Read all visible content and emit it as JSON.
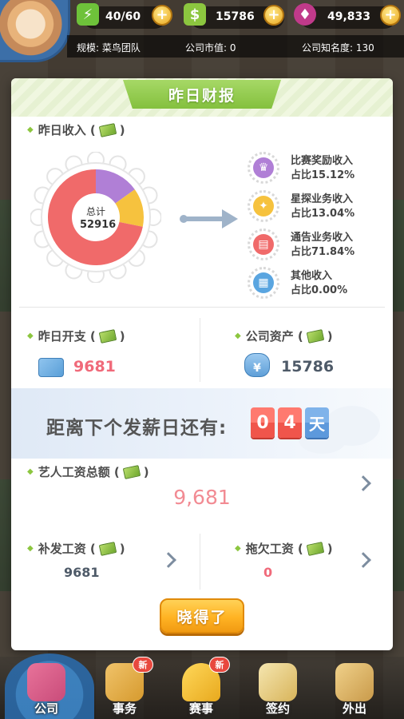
{
  "hud": {
    "energy": "40/60",
    "cash": "15786",
    "gems": "49,833",
    "plus": "+",
    "scale": "规模: 菜鸟团队",
    "market_value": "公司市值: 0",
    "fame": "公司知名度: 130"
  },
  "dialog": {
    "title": "昨日财报",
    "income_title": "昨日收入 (",
    "income_close": ")",
    "total_label": "总计",
    "total_value": "52916",
    "legend": [
      {
        "name": "比赛奖励收入",
        "pct": "占比15.12%",
        "color": "#b07fd6",
        "icon": "trophy-icon"
      },
      {
        "name": "星探业务收入",
        "pct": "占比13.04%",
        "color": "#f6c23e",
        "icon": "star-scout-icon"
      },
      {
        "name": "通告业务收入",
        "pct": "占比71.84%",
        "color": "#f06a6a",
        "icon": "clapperboard-icon"
      },
      {
        "name": "其他收入",
        "pct": "占比0.00%",
        "color": "#5aa5e0",
        "icon": "grid-icon"
      }
    ],
    "expense_title": "昨日开支 (",
    "expense_value": "9681",
    "assets_title": "公司资产 (",
    "assets_value": "15786",
    "assets_symbol": "¥",
    "countdown_text": "距离下个发薪日还有:",
    "countdown_digits": [
      "0",
      "4"
    ],
    "countdown_unit": "天",
    "wage_total_title": "艺人工资总额 (",
    "wage_total_value": "9,681",
    "backpay_title": "补发工资 (",
    "backpay_value": "9681",
    "arrears_title": "拖欠工资 (",
    "arrears_value": "0",
    "ok_button": "晓得了"
  },
  "chart_data": {
    "type": "pie",
    "categories": [
      "比赛奖励收入",
      "星探业务收入",
      "通告业务收入",
      "其他收入"
    ],
    "values": [
      15.12,
      13.04,
      71.84,
      0.0
    ],
    "colors": [
      "#b07fd6",
      "#f6c23e",
      "#f06a6a",
      "#5aa5e0"
    ],
    "title": "",
    "center_label": "总计",
    "center_value": 52916
  },
  "nav": [
    {
      "label": "公司",
      "badge": ""
    },
    {
      "label": "事务",
      "badge": "新"
    },
    {
      "label": "赛事",
      "badge": "新"
    },
    {
      "label": "签约",
      "badge": ""
    },
    {
      "label": "外出",
      "badge": ""
    }
  ]
}
